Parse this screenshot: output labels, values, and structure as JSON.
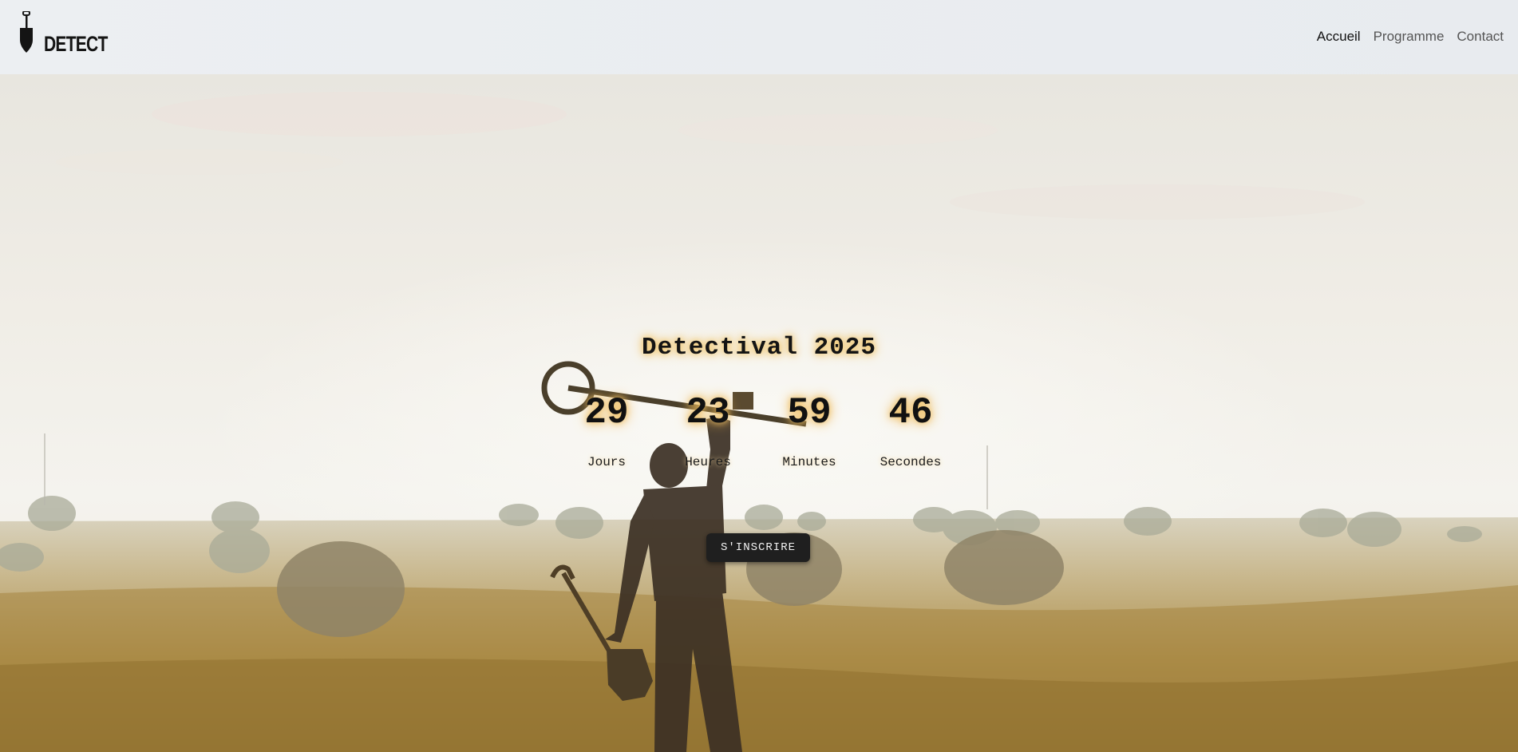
{
  "brand": {
    "logo_text": "DETECT"
  },
  "nav": {
    "items": [
      {
        "label": "Accueil"
      },
      {
        "label": "Programme"
      },
      {
        "label": "Contact"
      }
    ]
  },
  "hero": {
    "title": "Detectival 2025",
    "countdown": [
      {
        "value": "29",
        "label": "Jours"
      },
      {
        "value": "23",
        "label": "Heures"
      },
      {
        "value": "59",
        "label": "Minutes"
      },
      {
        "value": "46",
        "label": "Secondes"
      }
    ],
    "cta_label": "S'INSCRIRE"
  },
  "colors": {
    "header_bg": "#eceff2",
    "cta_bg": "#1f1f1f",
    "text_glow": "#f0b94a"
  }
}
